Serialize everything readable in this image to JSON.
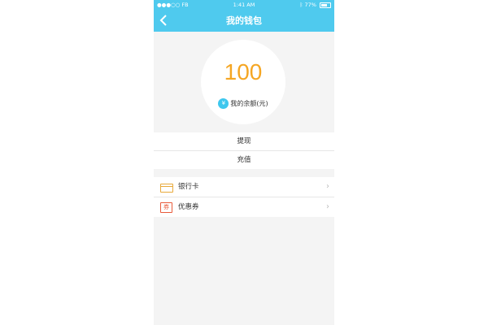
{
  "status_bar": {
    "carrier": "●●●○○ FB",
    "time": "1:41 AM",
    "battery": "77%"
  },
  "header": {
    "title": "我的钱包"
  },
  "wallet": {
    "amount": "100",
    "currency_symbol": "¥",
    "label": "我的余额(元)"
  },
  "actions": {
    "withdraw": "提现",
    "recharge": "充值"
  },
  "list": [
    {
      "icon": "bank-card-icon",
      "label": "银行卡"
    },
    {
      "icon": "coupon-icon",
      "label": "优惠券",
      "icon_text": "券"
    }
  ],
  "colors": {
    "header": "#4fcaee",
    "amount": "#f5a623",
    "currency_badge": "#3ec7ee"
  }
}
